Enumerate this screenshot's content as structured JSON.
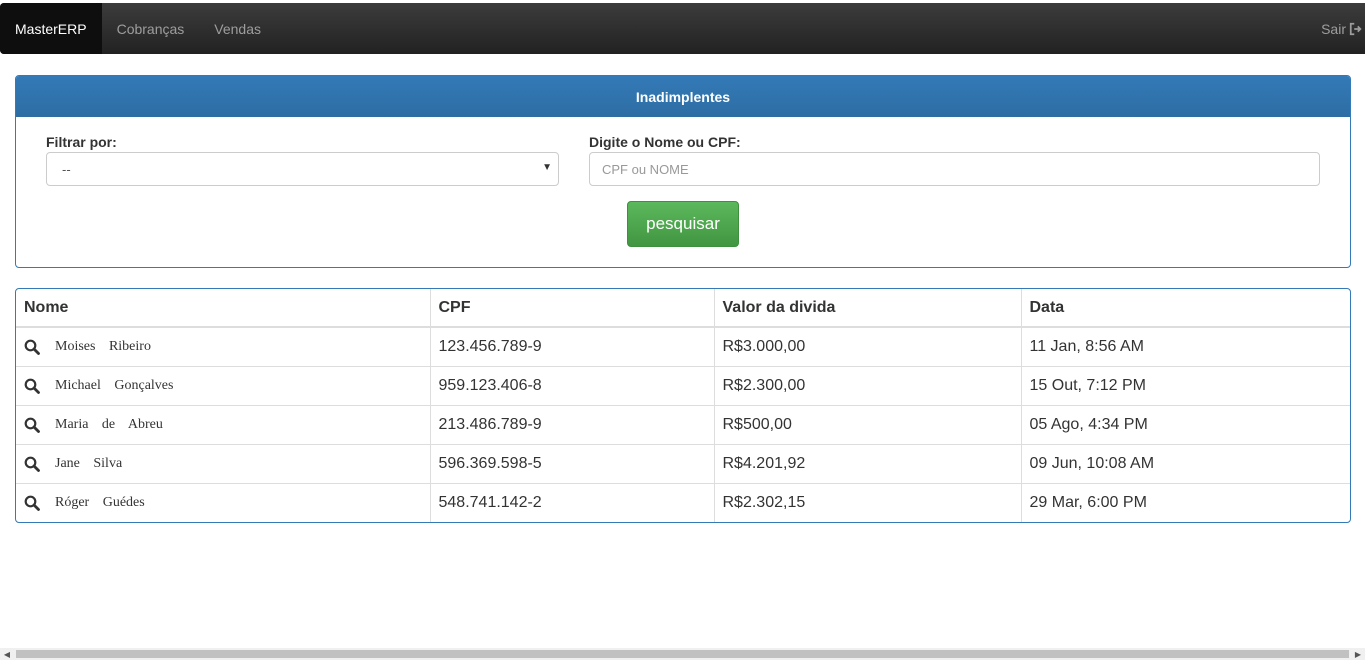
{
  "navbar": {
    "brand": "MasterERP",
    "links": [
      "Cobranças",
      "Vendas"
    ],
    "logout_label": "Sair",
    "logout_icon": "sign-out-icon"
  },
  "panel": {
    "title": "Inadimplentes",
    "filter_label": "Filtrar por:",
    "filter_value": "--",
    "search_label": "Digite o Nome ou CPF:",
    "search_placeholder": "CPF ou NOME",
    "search_value": "",
    "search_button": "pesquisar"
  },
  "table": {
    "headers": [
      "Nome",
      "CPF",
      "Valor da divida",
      "Data"
    ],
    "row_icon": "search-icon",
    "rows": [
      {
        "nome": "Moises Ribeiro",
        "cpf": "123.456.789-9",
        "valor": "R$3.000,00",
        "data": "11 Jan, 8:56 AM"
      },
      {
        "nome": "Michael Gonçalves",
        "cpf": "959.123.406-8",
        "valor": "R$2.300,00",
        "data": "15 Out, 7:12 PM"
      },
      {
        "nome": "Maria de Abreu",
        "cpf": "213.486.789-9",
        "valor": "R$500,00",
        "data": "05 Ago, 4:34 PM"
      },
      {
        "nome": "Jane Silva",
        "cpf": "596.369.598-5",
        "valor": "R$4.201,92",
        "data": "09 Jun, 10:08 AM"
      },
      {
        "nome": "Róger Guédes",
        "cpf": "548.741.142-2",
        "valor": "R$2.302,15",
        "data": "29 Mar, 6:00 PM"
      }
    ]
  },
  "colors": {
    "navbar": "#222222",
    "primary": "#337ab7",
    "success": "#5cb85c"
  }
}
